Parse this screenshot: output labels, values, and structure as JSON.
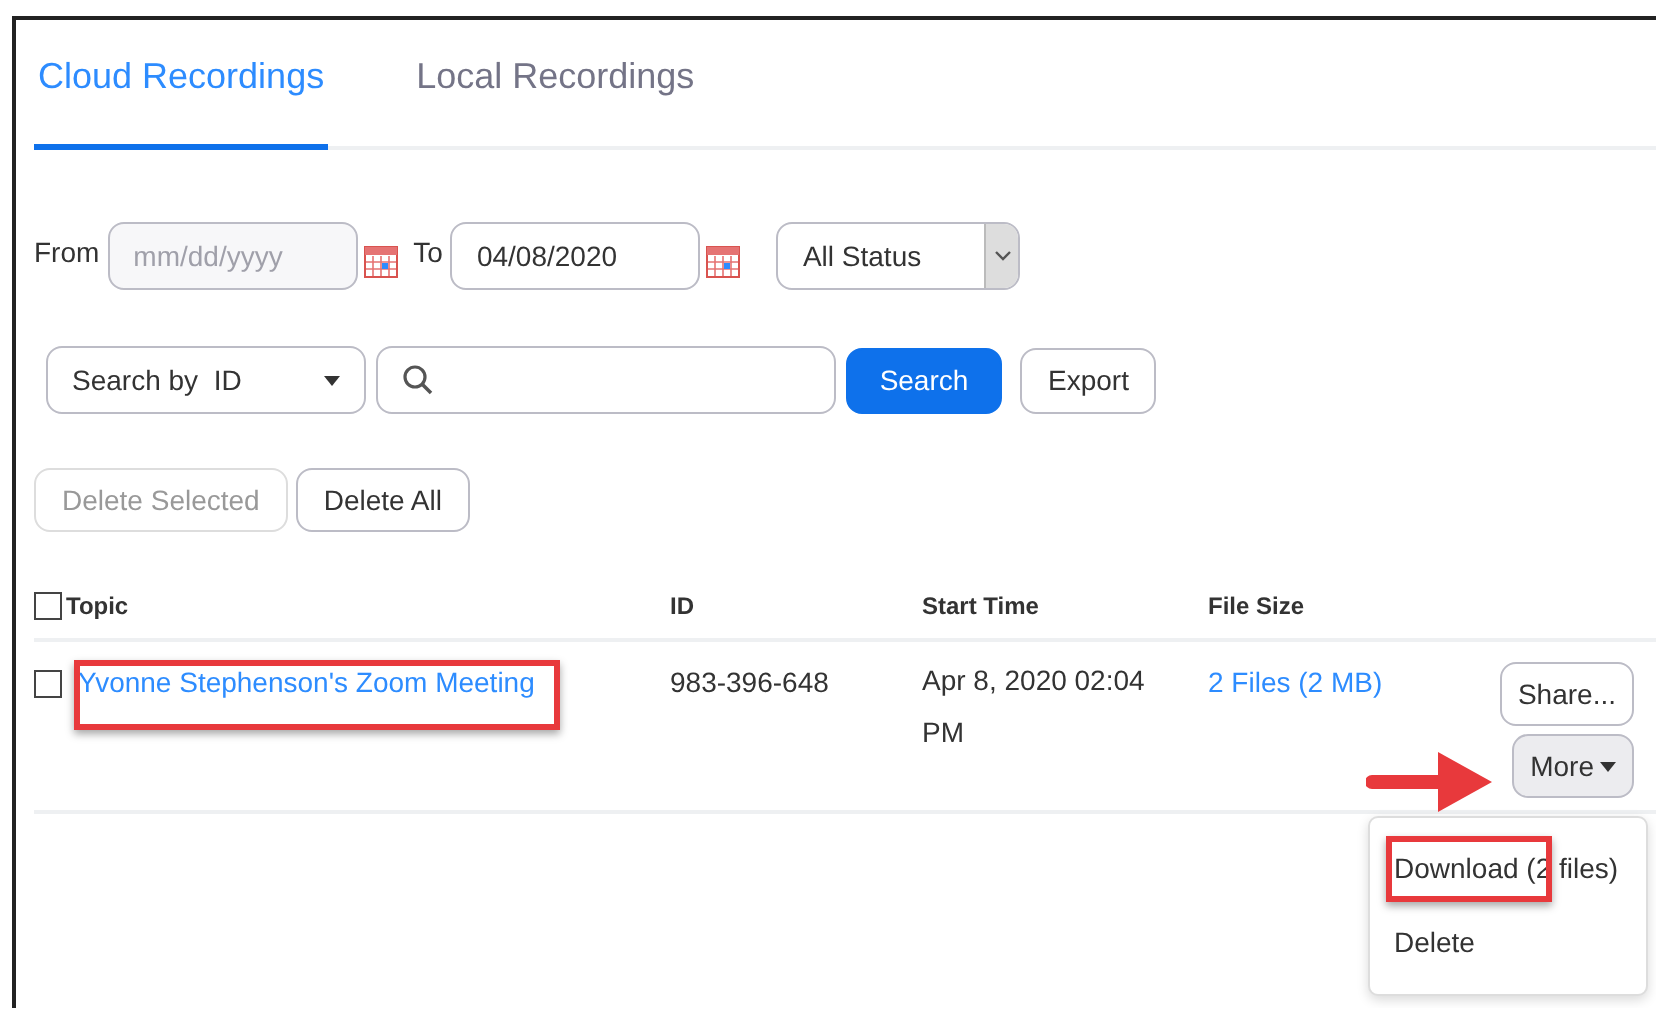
{
  "tabs": [
    {
      "label": "Cloud Recordings",
      "selected": true
    },
    {
      "label": "Local Recordings",
      "selected": false
    }
  ],
  "filters": {
    "from_label": "From",
    "from_placeholder": "mm/dd/yyyy",
    "to_label": "To",
    "to_value": "04/08/2020",
    "status": "All Status"
  },
  "search": {
    "search_by": "Search by",
    "search_by_value": "ID",
    "button": "Search",
    "export": "Export"
  },
  "bulk_buttons": [
    {
      "label": "Delete Selected",
      "disabled": true
    },
    {
      "label": "Delete All",
      "disabled": false
    }
  ],
  "table": {
    "select_all_checked": false,
    "columns": [
      "Topic",
      "ID",
      "Start Time",
      "File Size"
    ],
    "rows": [
      {
        "checked": false,
        "topic": "Yvonne Stephenson's Zoom Meeting",
        "id": "983-396-648",
        "start_time": "Apr 8, 2020 02:04 PM",
        "file_size": "2 Files (2 MB)",
        "actions": [
          "Share...",
          "More"
        ]
      }
    ]
  },
  "menu": [
    "Download (2 files)",
    "Delete"
  ]
}
